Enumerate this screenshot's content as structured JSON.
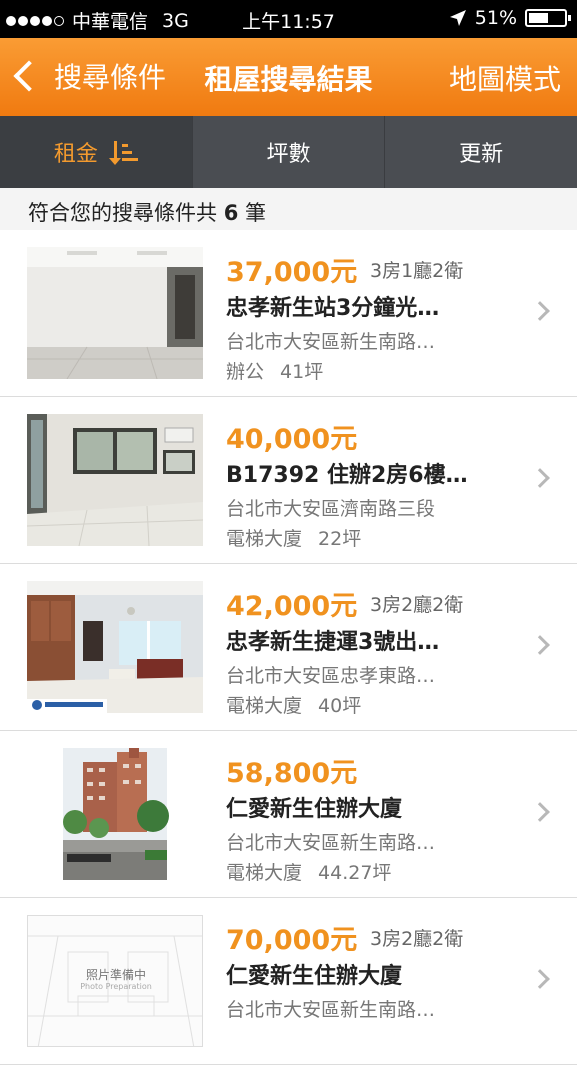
{
  "status_bar": {
    "carrier": "中華電信",
    "network": "3G",
    "time": "上午11:57",
    "battery": "51%",
    "battery_level": 0.51
  },
  "nav": {
    "back_label": "搜尋條件",
    "title": "租屋搜尋結果",
    "map_label": "地圖模式"
  },
  "sort_tabs": [
    {
      "label": "租金",
      "active": true
    },
    {
      "label": "坪數",
      "active": false
    },
    {
      "label": "更新",
      "active": false
    }
  ],
  "result_summary": {
    "prefix": "符合您的搜尋條件共",
    "count": "6",
    "suffix": "筆"
  },
  "listings": [
    {
      "price": "37,000元",
      "rooms": "3房1廳2衛",
      "name": "忠孝新生站3分鐘光…",
      "address": "台北市大安區新生南路…",
      "type": "辦公",
      "size": "41坪"
    },
    {
      "price": "40,000元",
      "rooms": "",
      "name": "B17392 住辦2房6樓…",
      "address": "台北市大安區濟南路三段",
      "type": "電梯大廈",
      "size": "22坪"
    },
    {
      "price": "42,000元",
      "rooms": "3房2廳2衛",
      "name": "忠孝新生捷運3號出…",
      "address": "台北市大安區忠孝東路…",
      "type": "電梯大廈",
      "size": "40坪"
    },
    {
      "price": "58,800元",
      "rooms": "",
      "name": "仁愛新生住辦大廈",
      "address": "台北市大安區新生南路…",
      "type": "電梯大廈",
      "size": "44.27坪"
    },
    {
      "price": "70,000元",
      "rooms": "3房2廳2衛",
      "name": "仁愛新生住辦大廈",
      "address": "台北市大安區新生南路…",
      "type": "",
      "size": ""
    }
  ],
  "photo_placeholder": {
    "label": "照片準備中",
    "sublabel": "Photo Preparation"
  },
  "colors": {
    "accent": "#f0921f",
    "nav_bar": "#f58a1f",
    "sort_bar": "#4a4d52"
  }
}
